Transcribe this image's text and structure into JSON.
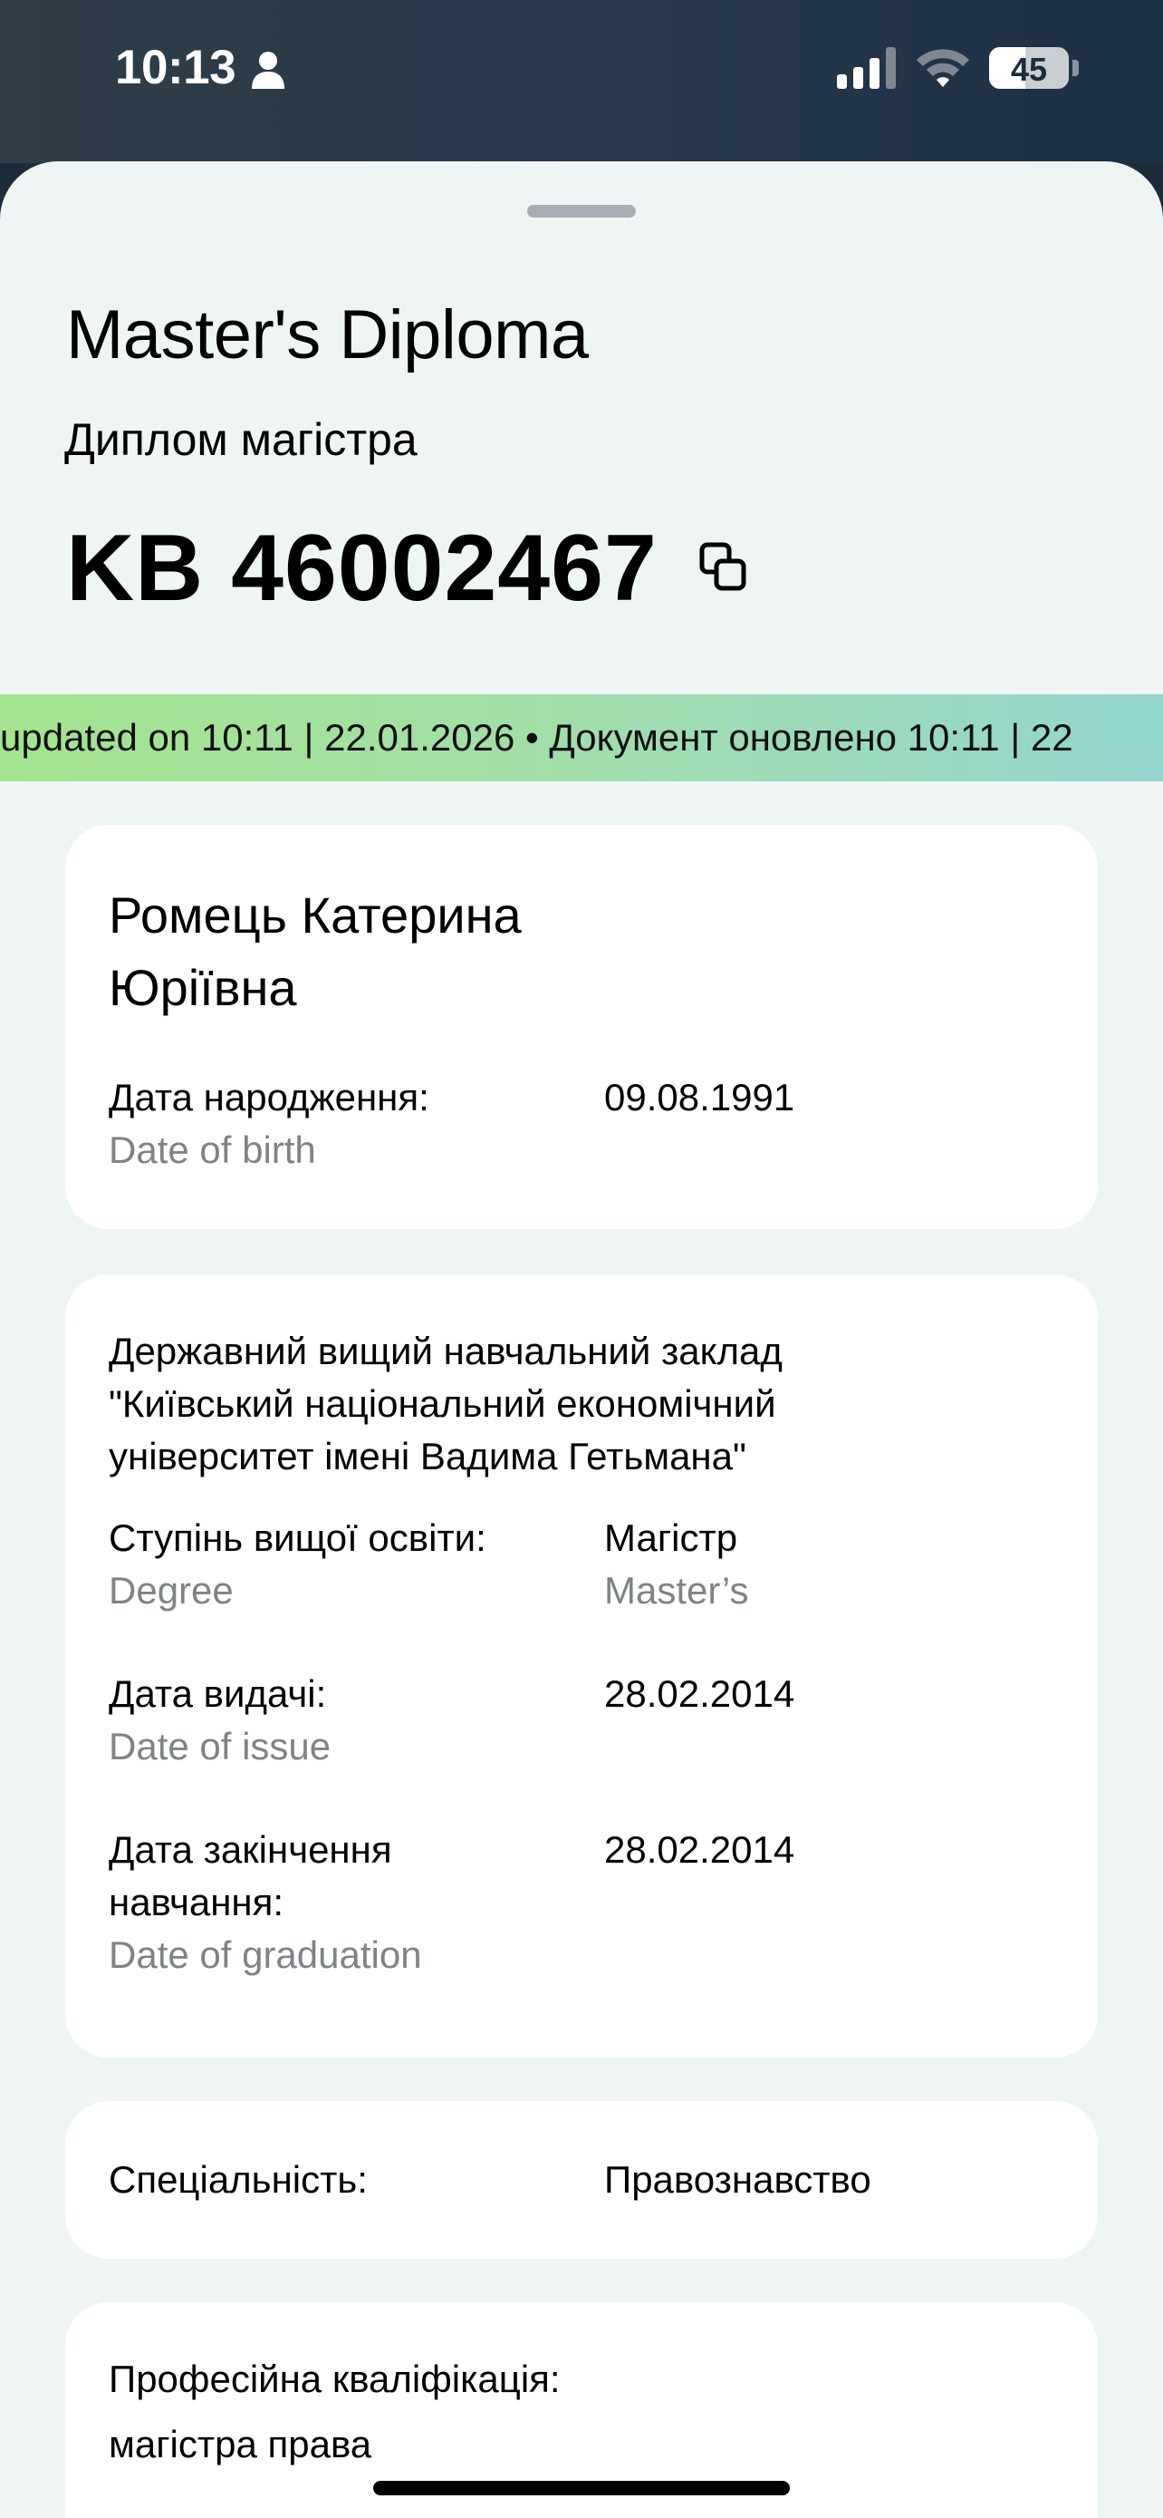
{
  "status_bar": {
    "time": "10:13",
    "battery_level": "45",
    "battery_fraction": 0.45,
    "icons": [
      "person-icon",
      "signal-icon",
      "wifi-icon",
      "battery-icon"
    ]
  },
  "header": {
    "title": "Master's Diploma",
    "subtitle": "Диплом магістра",
    "document_number": "KB 46002467",
    "copy_icon": "copy-icon"
  },
  "ticker": {
    "text": "updated on 10:11 | 22.01.2026 • Документ оновлено 10:11 | 22"
  },
  "person": {
    "name": "Ромець Катерина Юріївна",
    "birth_label": "Дата народження:",
    "birth_sub": "Date of birth",
    "birth_value": "09.08.1991"
  },
  "education": {
    "institution": "Державний вищий навчальний заклад \"Київський національний економічний університет імені Вадима Гетьмана\"",
    "degree_label": "Ступінь вищої освіти:",
    "degree_sub": "Degree",
    "degree_value": "Магістр",
    "degree_value_sub": "Master’s",
    "issue_label": "Дата видачі:",
    "issue_sub": "Date of issue",
    "issue_value": "28.02.2014",
    "graduation_label": "Дата закінчення навчання:",
    "graduation_sub": "Date of graduation",
    "graduation_value": "28.02.2014"
  },
  "specialty": {
    "label": "Спеціальність:",
    "value": "Правознавство"
  },
  "qualification": {
    "label": "Професійна кваліфікація:",
    "value": "магістра права"
  },
  "colors": {
    "sheet_bg": "#eff5f5",
    "ticker_start": "#a5e48e",
    "ticker_end": "#94d5cf",
    "secondary_text": "#7e8386"
  }
}
